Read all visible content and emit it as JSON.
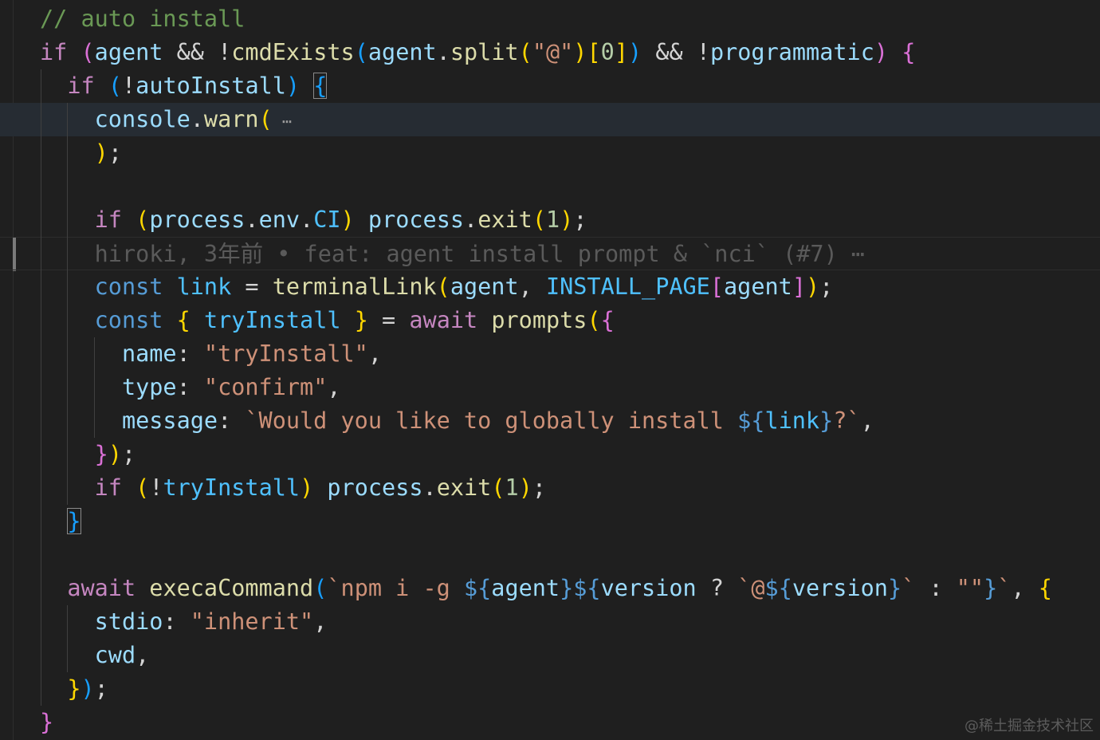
{
  "editor": {
    "lines": [
      {
        "tokens": [
          {
            "t": "// auto install",
            "k": "cm"
          }
        ]
      },
      {
        "tokens": [
          {
            "t": "if",
            "k": "kw"
          },
          {
            "t": " ",
            "k": "p"
          },
          {
            "t": "(",
            "k": "b2"
          },
          {
            "t": "agent",
            "k": "var"
          },
          {
            "t": " && !",
            "k": "p"
          },
          {
            "t": "cmdExists",
            "k": "fn"
          },
          {
            "t": "(",
            "k": "b3"
          },
          {
            "t": "agent",
            "k": "var"
          },
          {
            "t": ".",
            "k": "p"
          },
          {
            "t": "split",
            "k": "fn"
          },
          {
            "t": "(",
            "k": "b1"
          },
          {
            "t": "\"@\"",
            "k": "str"
          },
          {
            "t": ")",
            "k": "b1"
          },
          {
            "t": "[",
            "k": "b1"
          },
          {
            "t": "0",
            "k": "num"
          },
          {
            "t": "]",
            "k": "b1"
          },
          {
            "t": ")",
            "k": "b3"
          },
          {
            "t": " && !",
            "k": "p"
          },
          {
            "t": "programmatic",
            "k": "var"
          },
          {
            "t": ")",
            "k": "b2"
          },
          {
            "t": " ",
            "k": "p"
          },
          {
            "t": "{",
            "k": "b2"
          }
        ]
      },
      {
        "tokens": [
          {
            "t": "  ",
            "k": "p"
          },
          {
            "t": "if",
            "k": "kw"
          },
          {
            "t": " ",
            "k": "p"
          },
          {
            "t": "(",
            "k": "b3"
          },
          {
            "t": "!",
            "k": "p"
          },
          {
            "t": "autoInstall",
            "k": "var"
          },
          {
            "t": ")",
            "k": "b3"
          },
          {
            "t": " ",
            "k": "p"
          },
          {
            "t": "{",
            "k": "b3",
            "m": true
          }
        ]
      },
      {
        "tokens": [
          {
            "t": "    ",
            "k": "p"
          },
          {
            "t": "console",
            "k": "var"
          },
          {
            "t": ".",
            "k": "p"
          },
          {
            "t": "warn",
            "k": "fn"
          },
          {
            "t": "(",
            "k": "b1"
          },
          {
            "t": " ⋯",
            "k": "fold"
          }
        ]
      },
      {
        "tokens": [
          {
            "t": "    ",
            "k": "p"
          },
          {
            "t": ")",
            "k": "b1"
          },
          {
            "t": ";",
            "k": "p"
          }
        ]
      },
      {
        "tokens": []
      },
      {
        "tokens": [
          {
            "t": "    ",
            "k": "p"
          },
          {
            "t": "if",
            "k": "kw"
          },
          {
            "t": " ",
            "k": "p"
          },
          {
            "t": "(",
            "k": "b1"
          },
          {
            "t": "process",
            "k": "var"
          },
          {
            "t": ".",
            "k": "p"
          },
          {
            "t": "env",
            "k": "var"
          },
          {
            "t": ".",
            "k": "p"
          },
          {
            "t": "CI",
            "k": "const"
          },
          {
            "t": ")",
            "k": "b1"
          },
          {
            "t": " ",
            "k": "p"
          },
          {
            "t": "process",
            "k": "var"
          },
          {
            "t": ".",
            "k": "p"
          },
          {
            "t": "exit",
            "k": "fn"
          },
          {
            "t": "(",
            "k": "b1"
          },
          {
            "t": "1",
            "k": "num"
          },
          {
            "t": ")",
            "k": "b1"
          },
          {
            "t": ";",
            "k": "p"
          }
        ]
      },
      {
        "tokens": [
          {
            "t": "    ",
            "k": "p"
          },
          {
            "t": "hiroki, 3年前 • feat: agent install prompt & `nci` (#7) ⋯",
            "k": "blame"
          }
        ]
      },
      {
        "tokens": [
          {
            "t": "    ",
            "k": "p"
          },
          {
            "t": "const",
            "k": "st"
          },
          {
            "t": " ",
            "k": "p"
          },
          {
            "t": "link",
            "k": "const"
          },
          {
            "t": " = ",
            "k": "p"
          },
          {
            "t": "terminalLink",
            "k": "fn"
          },
          {
            "t": "(",
            "k": "b1"
          },
          {
            "t": "agent",
            "k": "var"
          },
          {
            "t": ", ",
            "k": "p"
          },
          {
            "t": "INSTALL_PAGE",
            "k": "const"
          },
          {
            "t": "[",
            "k": "b2"
          },
          {
            "t": "agent",
            "k": "var"
          },
          {
            "t": "]",
            "k": "b2"
          },
          {
            "t": ")",
            "k": "b1"
          },
          {
            "t": ";",
            "k": "p"
          }
        ]
      },
      {
        "tokens": [
          {
            "t": "    ",
            "k": "p"
          },
          {
            "t": "const",
            "k": "st"
          },
          {
            "t": " ",
            "k": "p"
          },
          {
            "t": "{",
            "k": "b1"
          },
          {
            "t": " ",
            "k": "p"
          },
          {
            "t": "tryInstall",
            "k": "const"
          },
          {
            "t": " ",
            "k": "p"
          },
          {
            "t": "}",
            "k": "b1"
          },
          {
            "t": " = ",
            "k": "p"
          },
          {
            "t": "await",
            "k": "kw"
          },
          {
            "t": " ",
            "k": "p"
          },
          {
            "t": "prompts",
            "k": "fn"
          },
          {
            "t": "(",
            "k": "b1"
          },
          {
            "t": "{",
            "k": "b2"
          }
        ]
      },
      {
        "tokens": [
          {
            "t": "      ",
            "k": "p"
          },
          {
            "t": "name",
            "k": "var"
          },
          {
            "t": ": ",
            "k": "p"
          },
          {
            "t": "\"tryInstall\"",
            "k": "str"
          },
          {
            "t": ",",
            "k": "p"
          }
        ]
      },
      {
        "tokens": [
          {
            "t": "      ",
            "k": "p"
          },
          {
            "t": "type",
            "k": "var"
          },
          {
            "t": ": ",
            "k": "p"
          },
          {
            "t": "\"confirm\"",
            "k": "str"
          },
          {
            "t": ",",
            "k": "p"
          }
        ]
      },
      {
        "tokens": [
          {
            "t": "      ",
            "k": "p"
          },
          {
            "t": "message",
            "k": "var"
          },
          {
            "t": ": ",
            "k": "p"
          },
          {
            "t": "`Would you like to globally install ",
            "k": "str"
          },
          {
            "t": "${",
            "k": "st"
          },
          {
            "t": "link",
            "k": "const"
          },
          {
            "t": "}",
            "k": "st"
          },
          {
            "t": "?`",
            "k": "str"
          },
          {
            "t": ",",
            "k": "p"
          }
        ]
      },
      {
        "tokens": [
          {
            "t": "    ",
            "k": "p"
          },
          {
            "t": "}",
            "k": "b2"
          },
          {
            "t": ")",
            "k": "b1"
          },
          {
            "t": ";",
            "k": "p"
          }
        ]
      },
      {
        "tokens": [
          {
            "t": "    ",
            "k": "p"
          },
          {
            "t": "if",
            "k": "kw"
          },
          {
            "t": " ",
            "k": "p"
          },
          {
            "t": "(",
            "k": "b1"
          },
          {
            "t": "!",
            "k": "p"
          },
          {
            "t": "tryInstall",
            "k": "const"
          },
          {
            "t": ")",
            "k": "b1"
          },
          {
            "t": " ",
            "k": "p"
          },
          {
            "t": "process",
            "k": "var"
          },
          {
            "t": ".",
            "k": "p"
          },
          {
            "t": "exit",
            "k": "fn"
          },
          {
            "t": "(",
            "k": "b1"
          },
          {
            "t": "1",
            "k": "num"
          },
          {
            "t": ")",
            "k": "b1"
          },
          {
            "t": ";",
            "k": "p"
          }
        ]
      },
      {
        "tokens": [
          {
            "t": "  ",
            "k": "p"
          },
          {
            "t": "}",
            "k": "b3",
            "m": true
          }
        ]
      },
      {
        "tokens": []
      },
      {
        "tokens": [
          {
            "t": "  ",
            "k": "p"
          },
          {
            "t": "await",
            "k": "kw"
          },
          {
            "t": " ",
            "k": "p"
          },
          {
            "t": "execaCommand",
            "k": "fn"
          },
          {
            "t": "(",
            "k": "b3"
          },
          {
            "t": "`npm i -g ",
            "k": "str"
          },
          {
            "t": "${",
            "k": "st"
          },
          {
            "t": "agent",
            "k": "var"
          },
          {
            "t": "}${",
            "k": "st"
          },
          {
            "t": "version",
            "k": "var"
          },
          {
            "t": " ? ",
            "k": "p"
          },
          {
            "t": "`@",
            "k": "str"
          },
          {
            "t": "${",
            "k": "st"
          },
          {
            "t": "version",
            "k": "var"
          },
          {
            "t": "}",
            "k": "st"
          },
          {
            "t": "`",
            "k": "str"
          },
          {
            "t": " : ",
            "k": "p"
          },
          {
            "t": "\"\"",
            "k": "str"
          },
          {
            "t": "}",
            "k": "st"
          },
          {
            "t": "`",
            "k": "str"
          },
          {
            "t": ", ",
            "k": "p"
          },
          {
            "t": "{",
            "k": "b1"
          }
        ]
      },
      {
        "tokens": [
          {
            "t": "    ",
            "k": "p"
          },
          {
            "t": "stdio",
            "k": "var"
          },
          {
            "t": ": ",
            "k": "p"
          },
          {
            "t": "\"inherit\"",
            "k": "str"
          },
          {
            "t": ",",
            "k": "p"
          }
        ]
      },
      {
        "tokens": [
          {
            "t": "    ",
            "k": "p"
          },
          {
            "t": "cwd",
            "k": "var"
          },
          {
            "t": ",",
            "k": "p"
          }
        ]
      },
      {
        "tokens": [
          {
            "t": "  ",
            "k": "p"
          },
          {
            "t": "}",
            "k": "b1"
          },
          {
            "t": ")",
            "k": "b3"
          },
          {
            "t": ";",
            "k": "p"
          }
        ]
      },
      {
        "tokens": [
          {
            "t": "}",
            "k": "b2"
          }
        ]
      }
    ]
  },
  "watermark": "@稀土掘金技术社区"
}
